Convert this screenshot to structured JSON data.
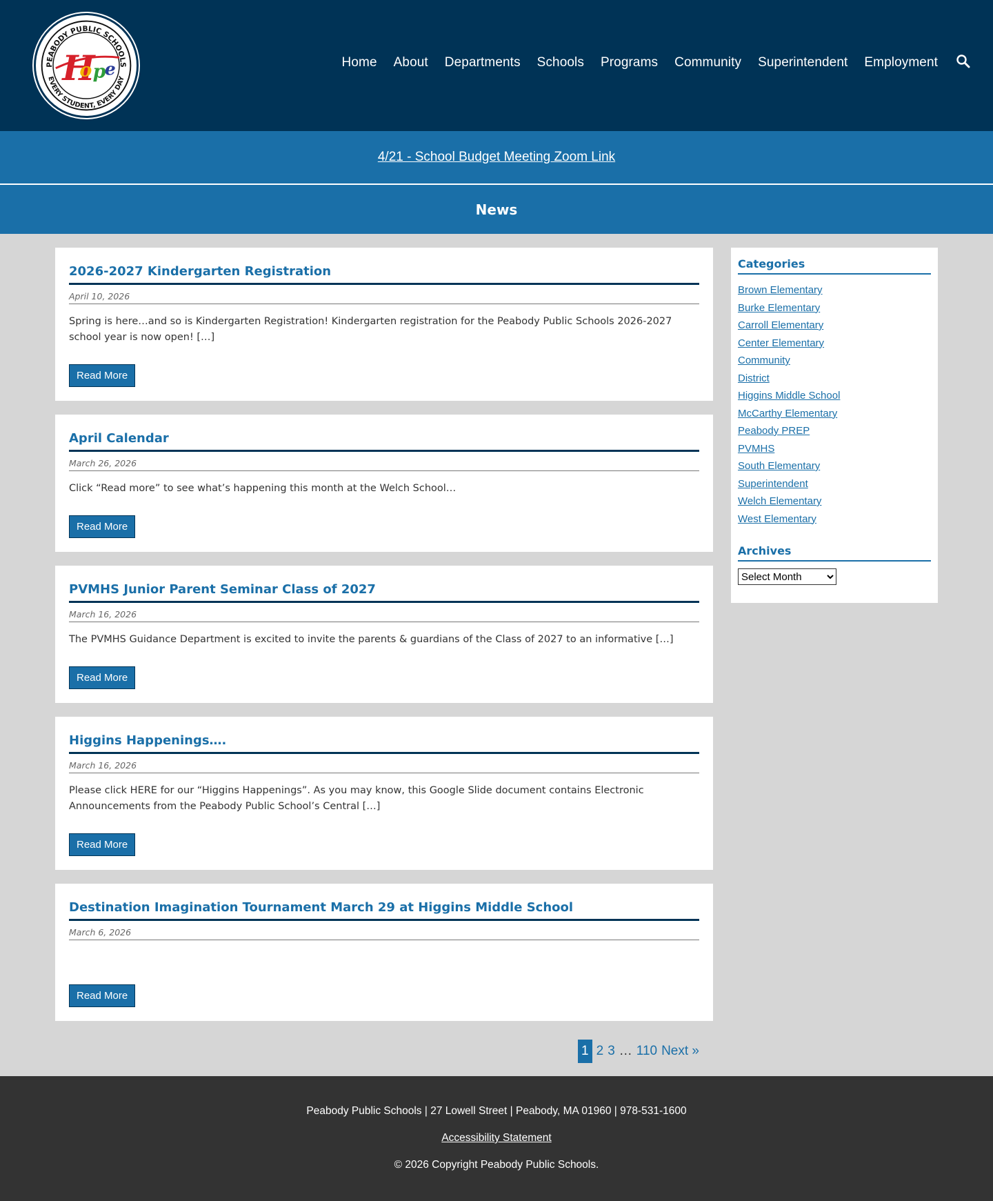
{
  "header": {
    "logo_text_top": "PEABODY PUBLIC SCHOOLS",
    "logo_text_bottom": "EVERY STUDENT, EVERY DAY",
    "logo_word": "Hope",
    "nav": [
      "Home",
      "About",
      "Departments",
      "Schools",
      "Programs",
      "Community",
      "Superintendent",
      "Employment"
    ],
    "search_icon": "search-icon"
  },
  "alert": {
    "link_text": "4/21 - School Budget Meeting Zoom Link"
  },
  "page_title": "News",
  "posts": [
    {
      "title": "2026-2027 Kindergarten Registration",
      "date": "April 10, 2026",
      "excerpt": "Spring is here…and so is Kindergarten Registration! Kindergarten registration for the Peabody Public Schools 2026-2027 school year is now open! […]",
      "button": "Read More"
    },
    {
      "title": "April Calendar",
      "date": "March 26, 2026",
      "excerpt": "Click “Read more” to see what’s happening this month at the Welch School…",
      "button": "Read More"
    },
    {
      "title": "PVMHS Junior Parent Seminar Class of 2027",
      "date": "March 16, 2026",
      "excerpt": "The PVMHS Guidance Department is excited to invite the parents & guardians of the Class of 2027 to an informative […]",
      "button": "Read More"
    },
    {
      "title": "Higgins Happenings….",
      "date": "March 16, 2026",
      "excerpt": "Please click HERE for our “Higgins Happenings”.  As you may know, this Google Slide document contains Electronic Announcements from the Peabody Public School’s Central […]",
      "button": "Read More"
    },
    {
      "title": "Destination Imagination Tournament March 29 at Higgins Middle School",
      "date": "March 6, 2026",
      "excerpt": "",
      "button": "Read More"
    }
  ],
  "pagination": {
    "current": "1",
    "pages": [
      "2",
      "3"
    ],
    "dots": "…",
    "last": "110",
    "next": "Next »"
  },
  "sidebar": {
    "categories_title": "Categories",
    "categories": [
      "Brown Elementary",
      "Burke Elementary",
      "Carroll Elementary",
      "Center Elementary",
      "Community",
      "District",
      "Higgins Middle School",
      "McCarthy Elementary",
      "Peabody PREP",
      "PVMHS",
      "South Elementary",
      "Superintendent",
      "Welch Elementary",
      "West Elementary"
    ],
    "archives_title": "Archives",
    "archives_selected": "Select Month"
  },
  "footer": {
    "address": "Peabody Public Schools | 27 Lowell Street | Peabody, MA 01960 | 978-531-1600",
    "accessibility": "Accessibility Statement",
    "copyright": "© 2026 Copyright Peabody Public Schools."
  },
  "colors": {
    "navy": "#003356",
    "blue": "#1a6fa8",
    "gray_bg": "#d6d6d6",
    "footer_bg": "#333333"
  }
}
